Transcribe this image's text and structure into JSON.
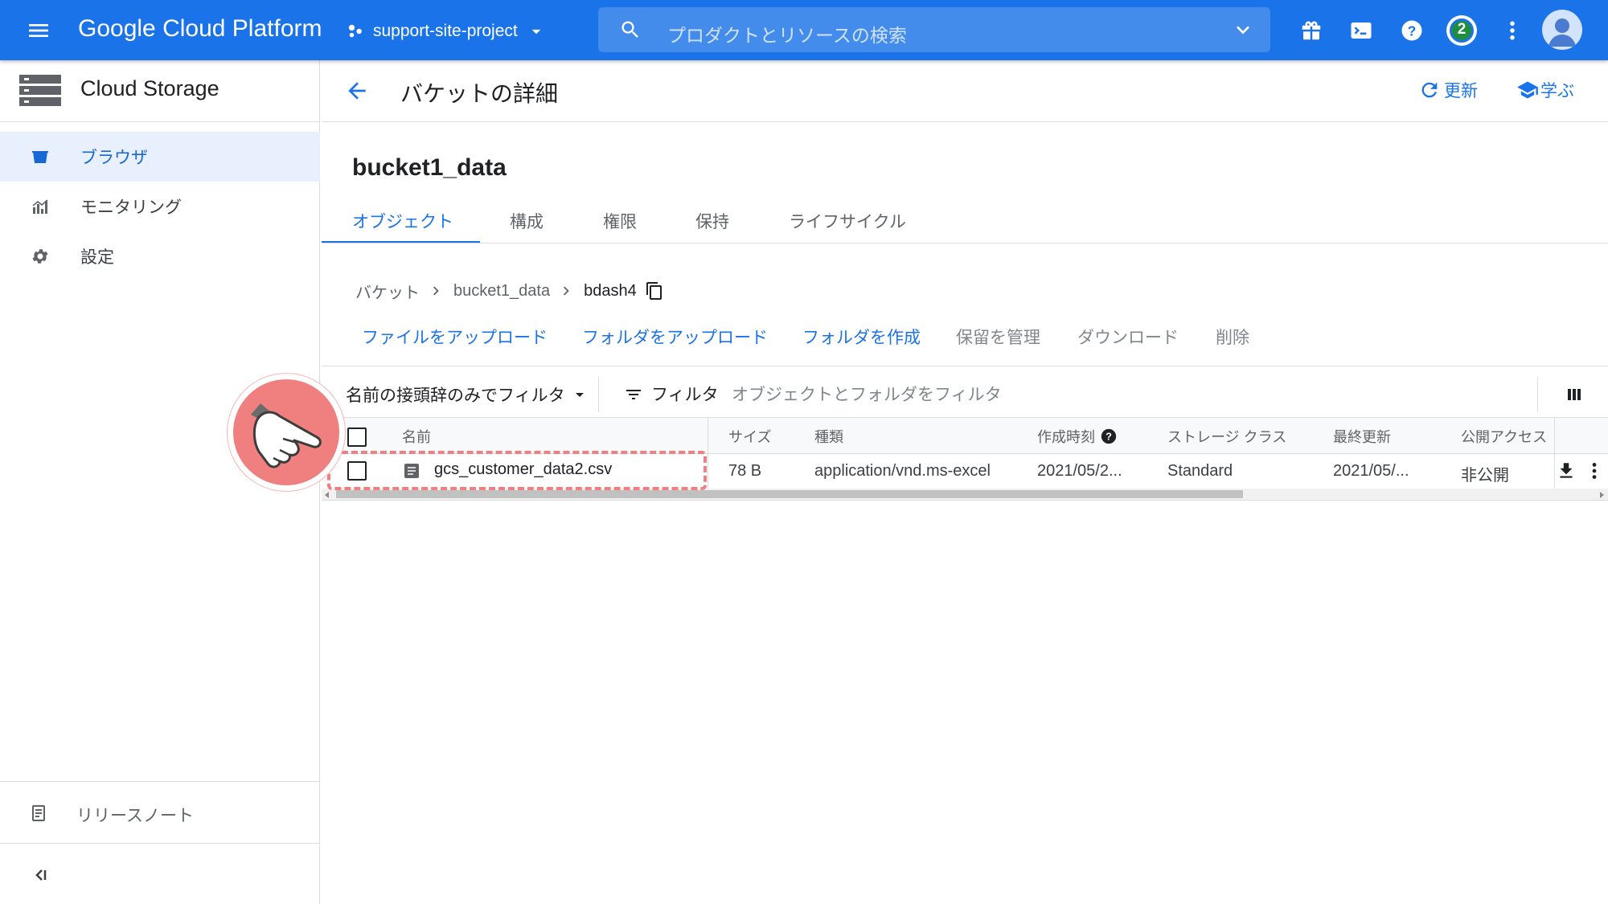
{
  "topbar": {
    "title": "Google Cloud Platform",
    "project": "support-site-project",
    "search_placeholder": "プロダクトとリソースの検索",
    "notification_count": "2",
    "brand_color": "#1a73e8"
  },
  "sidebar": {
    "title": "Cloud Storage",
    "items": [
      {
        "label": "ブラウザ",
        "icon": "bucket-icon",
        "active": true
      },
      {
        "label": "モニタリング",
        "icon": "chart-icon",
        "active": false
      },
      {
        "label": "設定",
        "icon": "gear-icon",
        "active": false
      }
    ],
    "release_notes": "リリースノート"
  },
  "header": {
    "title": "バケットの詳細",
    "refresh": "更新",
    "learn": "学ぶ"
  },
  "bucket": {
    "name": "bucket1_data",
    "tabs": [
      "オブジェクト",
      "構成",
      "権限",
      "保持",
      "ライフサイクル"
    ],
    "active_tab": "オブジェクト"
  },
  "breadcrumb": {
    "root": "バケット",
    "bucket": "bucket1_data",
    "folder": "bdash4"
  },
  "actions": [
    {
      "label": "ファイルをアップロード",
      "enabled": true
    },
    {
      "label": "フォルダをアップロード",
      "enabled": true
    },
    {
      "label": "フォルダを作成",
      "enabled": true
    },
    {
      "label": "保留を管理",
      "enabled": false
    },
    {
      "label": "ダウンロード",
      "enabled": false
    },
    {
      "label": "削除",
      "enabled": false
    }
  ],
  "filter": {
    "prefix_dropdown": "名前の接頭辞のみでフィルタ",
    "label": "フィルタ",
    "placeholder": "オブジェクトとフォルダをフィルタ"
  },
  "table": {
    "columns": [
      "名前",
      "サイズ",
      "種類",
      "作成時刻",
      "ストレージ クラス",
      "最終更新",
      "公開アクセス"
    ],
    "rows": [
      {
        "name": "gcs_customer_data2.csv",
        "size": "78 B",
        "type": "application/vnd.ms-excel",
        "created": "2021/05/2...",
        "storage_class": "Standard",
        "updated": "2021/05/...",
        "public_access": "非公開"
      }
    ]
  },
  "annotation": {
    "highlight_color": "#f08080",
    "pointer_icon": "pointing-hand-icon"
  }
}
